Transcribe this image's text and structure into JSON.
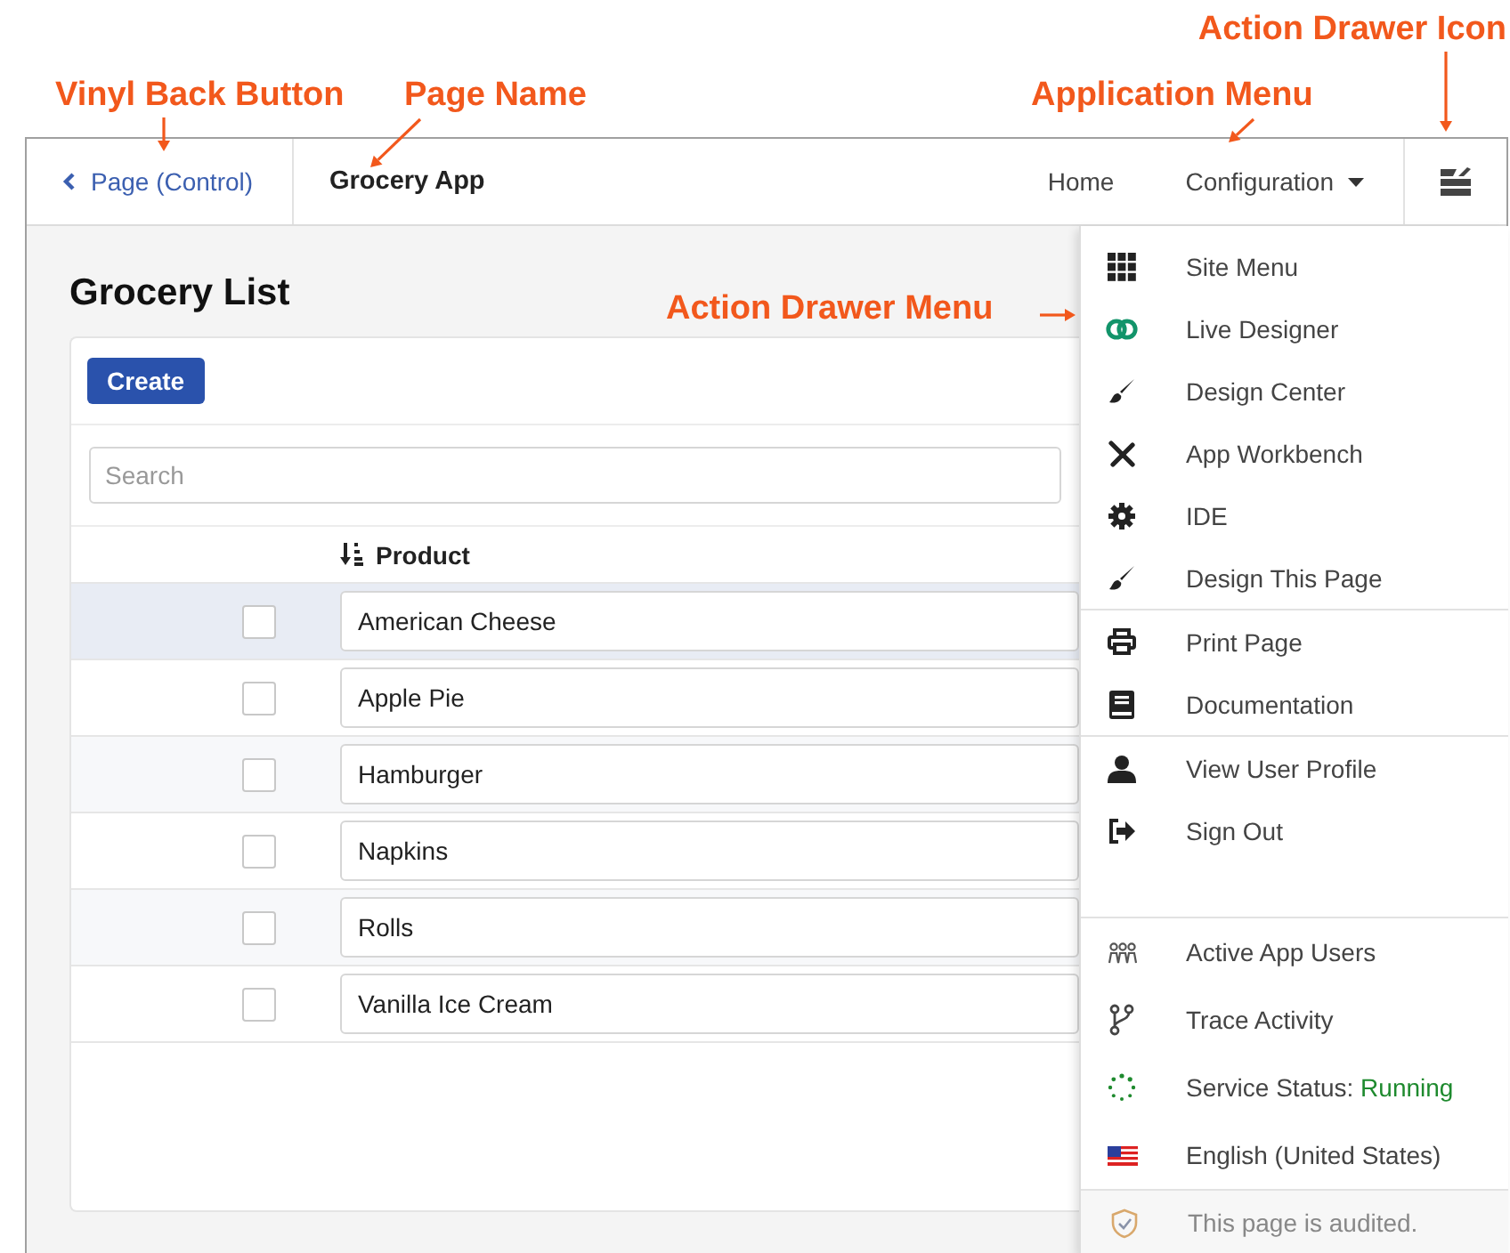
{
  "annotations": [
    {
      "text": "Action Drawer Icon"
    },
    {
      "text": "Vinyl Back Button"
    },
    {
      "text": "Page Name"
    },
    {
      "text": "Application Menu"
    },
    {
      "text": "Action Drawer Menu"
    }
  ],
  "header": {
    "back_link": "Page (Control)",
    "page_name": "Grocery App",
    "nav": [
      {
        "label": "Home",
        "dropdown": false
      },
      {
        "label": "Configuration",
        "dropdown": true
      }
    ]
  },
  "page": {
    "title": "Grocery List",
    "create_button": "Create",
    "search": {
      "placeholder": "Search"
    },
    "table": {
      "columns": [
        {
          "label": "Product",
          "sorted": true
        }
      ],
      "rows": [
        {
          "product": "American Cheese",
          "checked": false,
          "highlighted": true
        },
        {
          "product": "Apple Pie",
          "checked": false,
          "highlighted": false
        },
        {
          "product": "Hamburger",
          "checked": false,
          "highlighted": false
        },
        {
          "product": "Napkins",
          "checked": false,
          "highlighted": false
        },
        {
          "product": "Rolls",
          "checked": false,
          "highlighted": false
        },
        {
          "product": "Vanilla Ice Cream",
          "checked": false,
          "highlighted": false
        }
      ]
    }
  },
  "drawer": {
    "groups": [
      {
        "items": [
          {
            "label": "Site Menu"
          },
          {
            "label": "Live Designer"
          },
          {
            "label": "Design Center"
          },
          {
            "label": "App Workbench"
          },
          {
            "label": "IDE"
          },
          {
            "label": "Design This Page"
          }
        ]
      },
      {
        "items": [
          {
            "label": "Print Page"
          },
          {
            "label": "Documentation"
          }
        ]
      },
      {
        "items": [
          {
            "label": "View User Profile"
          },
          {
            "label": "Sign Out"
          }
        ]
      },
      {
        "items": [
          {
            "label": "Active App Users"
          },
          {
            "label": "Trace Activity"
          },
          {
            "label": "Service Status:",
            "status": "Running"
          },
          {
            "label": "English (United States)"
          }
        ]
      }
    ],
    "footer": "This page is audited."
  }
}
